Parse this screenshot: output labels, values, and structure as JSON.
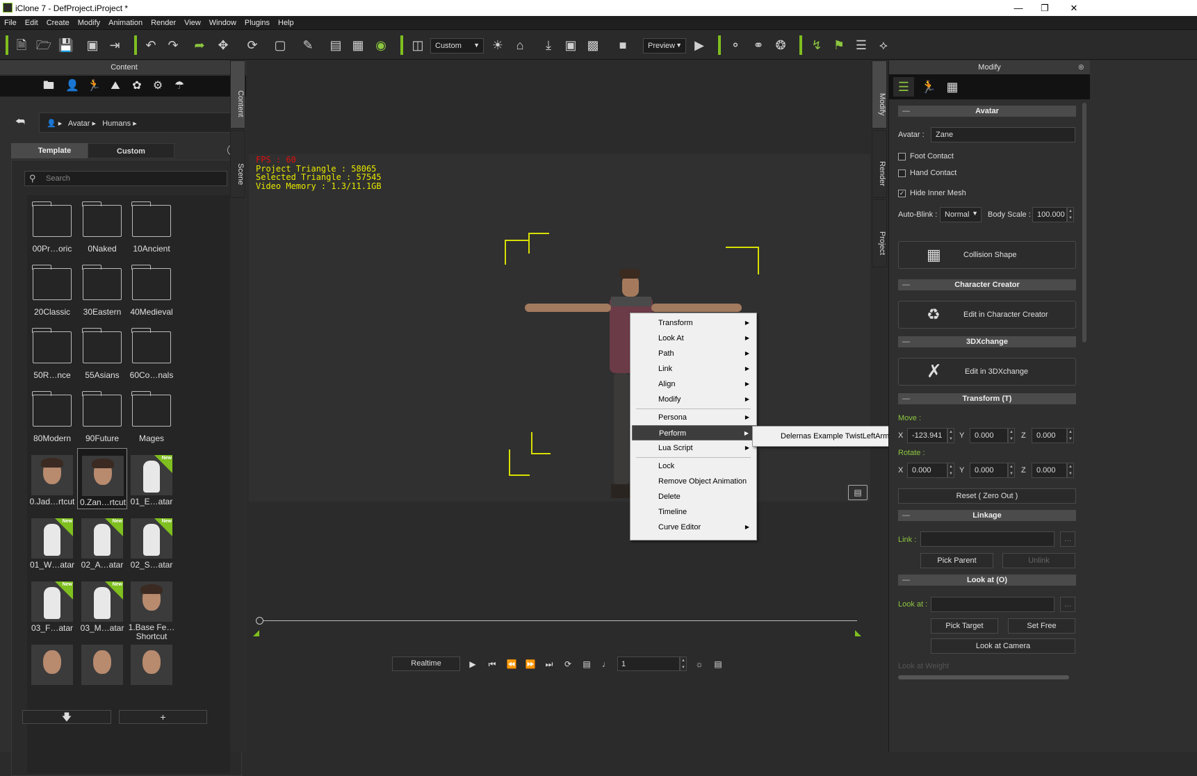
{
  "window": {
    "title": "iClone 7 - DefProject.iProject *"
  },
  "menu": [
    "File",
    "Edit",
    "Create",
    "Modify",
    "Animation",
    "Render",
    "View",
    "Window",
    "Plugins",
    "Help"
  ],
  "toolbar": {
    "view_mode": "Custom",
    "render_mode": "Preview"
  },
  "content_panel": {
    "title": "Content",
    "breadcrumb": [
      "Avatar",
      "Humans"
    ],
    "tabs": {
      "template": "Template",
      "custom": "Custom"
    },
    "search_placeholder": "Search",
    "folders": [
      "00Pr…oric",
      "0Naked",
      "10Ancient",
      "20Classic",
      "30Eastern",
      "40Medieval",
      "50R…nce",
      "55Asians",
      "60Co…nals",
      "80Modern",
      "90Future",
      "Mages"
    ],
    "avatars": [
      {
        "label": "0.Jad…rtcut",
        "new": false
      },
      {
        "label": "0.Zan…rtcut",
        "new": false,
        "selected": true
      },
      {
        "label": "01_E…atar",
        "new": true
      },
      {
        "label": "01_W…atar",
        "new": true
      },
      {
        "label": "02_A…atar",
        "new": true
      },
      {
        "label": "02_S…atar",
        "new": true
      },
      {
        "label": "03_F…atar",
        "new": true
      },
      {
        "label": "03_M…atar",
        "new": true
      },
      {
        "label": "1.Base Fe… Shortcut",
        "new": false
      }
    ],
    "new_badge": "New"
  },
  "side_tabs": {
    "left": [
      "Content",
      "Scene"
    ],
    "right": [
      "Modify",
      "Render",
      "Project"
    ]
  },
  "viewport": {
    "stats": {
      "fps": "FPS : 60",
      "project_triangle": "Project Triangle : 58065",
      "selected_triangle": "Selected Triangle : 57545",
      "video_memory": "Video Memory : 1.3/11.1GB"
    },
    "context_menu": [
      {
        "label": "Transform",
        "submenu": true
      },
      {
        "label": "Look At",
        "submenu": true
      },
      {
        "label": "Path",
        "submenu": true
      },
      {
        "label": "Link",
        "submenu": true
      },
      {
        "label": "Align",
        "submenu": true
      },
      {
        "label": "Modify",
        "submenu": true
      },
      {
        "label": "Persona",
        "submenu": true
      },
      {
        "label": "Perform",
        "submenu": true,
        "highlighted": true
      },
      {
        "label": "Lua Script",
        "submenu": true
      },
      {
        "label": "Lock",
        "submenu": false
      },
      {
        "label": "Remove Object  Animation",
        "submenu": false
      },
      {
        "label": "Delete",
        "submenu": false
      },
      {
        "label": "Timeline",
        "submenu": false
      },
      {
        "label": "Curve Editor",
        "submenu": true
      }
    ],
    "submenu_item": "Delernas Example TwistLeftArm",
    "playback": {
      "mode": "Realtime",
      "frame": "1"
    }
  },
  "modify_panel": {
    "title": "Modify",
    "avatar_section": "Avatar",
    "avatar_label": "Avatar :",
    "avatar_name": "Zane",
    "foot_contact": "Foot Contact",
    "hand_contact": "Hand Contact",
    "hide_inner_mesh": "Hide Inner Mesh",
    "hide_inner_mesh_checked": true,
    "auto_blink_label": "Auto-Blink :",
    "auto_blink": "Normal",
    "body_scale_label": "Body Scale :",
    "body_scale": "100.000",
    "collision_shape": "Collision Shape",
    "character_creator_section": "Character Creator",
    "edit_in_cc": "Edit in Character Creator",
    "threedx_section": "3DXchange",
    "edit_in_3dx": "Edit in 3DXchange",
    "transform_section": "Transform  (T)",
    "move_label": "Move :",
    "move": {
      "x": "-123.941",
      "y": "0.000",
      "z": "0.000"
    },
    "rotate_label": "Rotate :",
    "rotate": {
      "x": "0.000",
      "y": "0.000",
      "z": "0.000"
    },
    "axis": {
      "x": "X",
      "y": "Y",
      "z": "Z"
    },
    "reset": "Reset ( Zero Out )",
    "linkage_section": "Linkage",
    "link_label": "Link :",
    "pick_parent": "Pick Parent",
    "unlink": "Unlink",
    "lookat_section": "Look at  (O)",
    "lookat_label": "Look at :",
    "pick_target": "Pick Target",
    "set_free": "Set Free",
    "lookat_camera": "Look at Camera",
    "lookat_weight": "Look at Weight",
    "more": "…"
  },
  "colors": {
    "accent": "#7fbf1f",
    "stats_text": "#e8e800",
    "fps_text": "#e01010"
  }
}
